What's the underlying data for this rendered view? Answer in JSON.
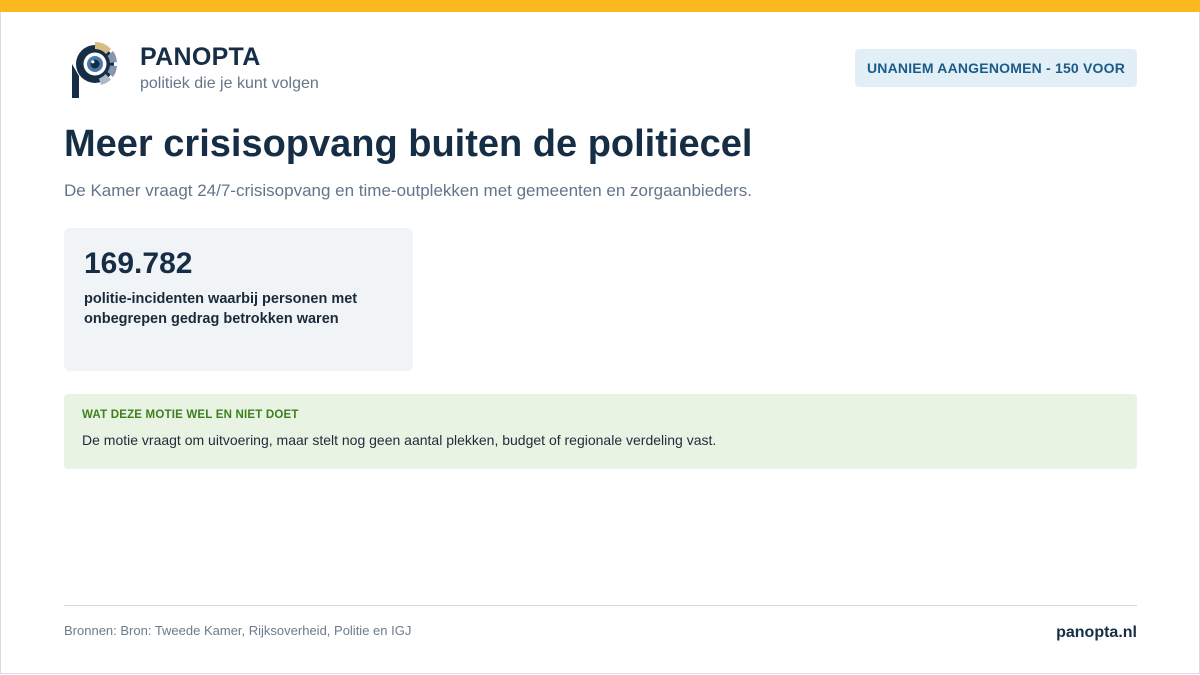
{
  "brand": {
    "name": "PANOPTA",
    "tagline": "politiek die je kunt volgen",
    "accent_color": "#fbb91e",
    "primary_color": "#162d46"
  },
  "status_badge": {
    "text": "UNANIEM AANGENOMEN - 150 VOOR"
  },
  "motion": {
    "title": "Meer crisisopvang buiten de politiecel",
    "subtitle": "De Kamer vraagt 24/7-crisisopvang en time-outplekken met gemeenten en zorgaanbieders."
  },
  "stat": {
    "value": "169.782",
    "label": "politie-incidenten waarbij personen met onbegrepen gedrag betrokken waren"
  },
  "info": {
    "heading": "WAT DEZE MOTIE WEL EN NIET DOET",
    "text": "De motie vraagt om uitvoering, maar stelt nog geen aantal plekken, budget of regionale verdeling vast.",
    "color": "#3d7f1e"
  },
  "footer": {
    "sources": "Bronnen: Bron: Tweede Kamer, Rijksoverheid, Politie en IGJ",
    "site": "panopta.nl"
  },
  "icons": {
    "logo": "panopta-eye-logo-icon"
  }
}
